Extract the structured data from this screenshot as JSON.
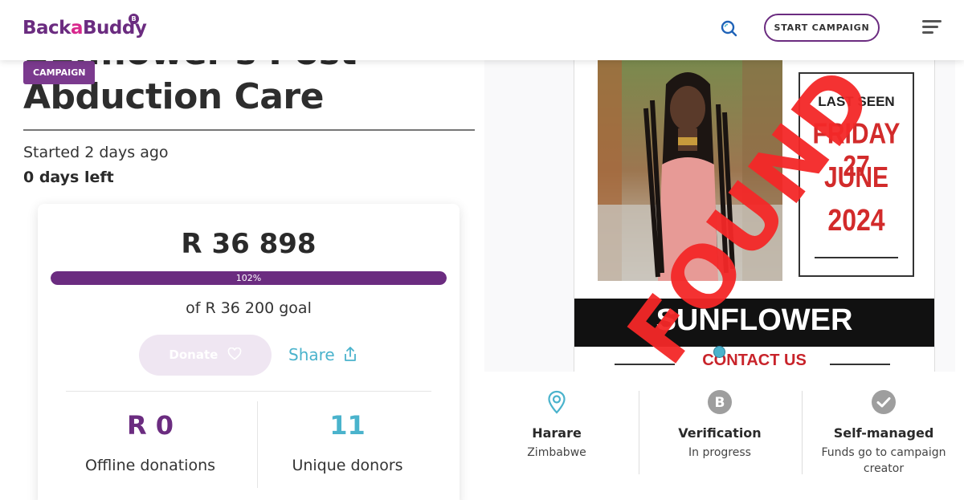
{
  "header": {
    "logo_main": "Back",
    "logo_a": "a",
    "logo_end": "Buddy",
    "logo_badge": "B",
    "start_campaign": "START CAMPAIGN"
  },
  "campaign": {
    "tag": "CAMPAIGN",
    "title_partial": "Sunflower's Post",
    "title": "Abduction Care",
    "started": "Started 2 days ago",
    "days_left": "0 days left"
  },
  "donation": {
    "raised": "R 36 898",
    "progress_percent": 102,
    "progress_label": "102%",
    "goal": "of R 36 200 goal",
    "donate_label": "Donate",
    "share_label": "Share",
    "offline_value": "R 0",
    "offline_label": "Offline donations",
    "donors_value": "11",
    "donors_label": "Unique donors"
  },
  "poster": {
    "last_seen_line1": "LAST SEEN",
    "last_seen_line2": "FRIDAY 27",
    "last_seen_line3": "JUNE",
    "last_seen_line4": "2024",
    "name": "SUNFLOWER",
    "contact": "CONTACT US",
    "stamp": "FOUND"
  },
  "info": {
    "location_title": "Harare",
    "location_sub": "Zimbabwe",
    "verification_title": "Verification",
    "verification_sub": "In progress",
    "managed_title": "Self-managed",
    "managed_sub": "Funds go to campaign creator"
  },
  "colors": {
    "brand_purple": "#6b2c80",
    "accent_teal": "#4ab3cc",
    "found_red": "#f22424"
  }
}
